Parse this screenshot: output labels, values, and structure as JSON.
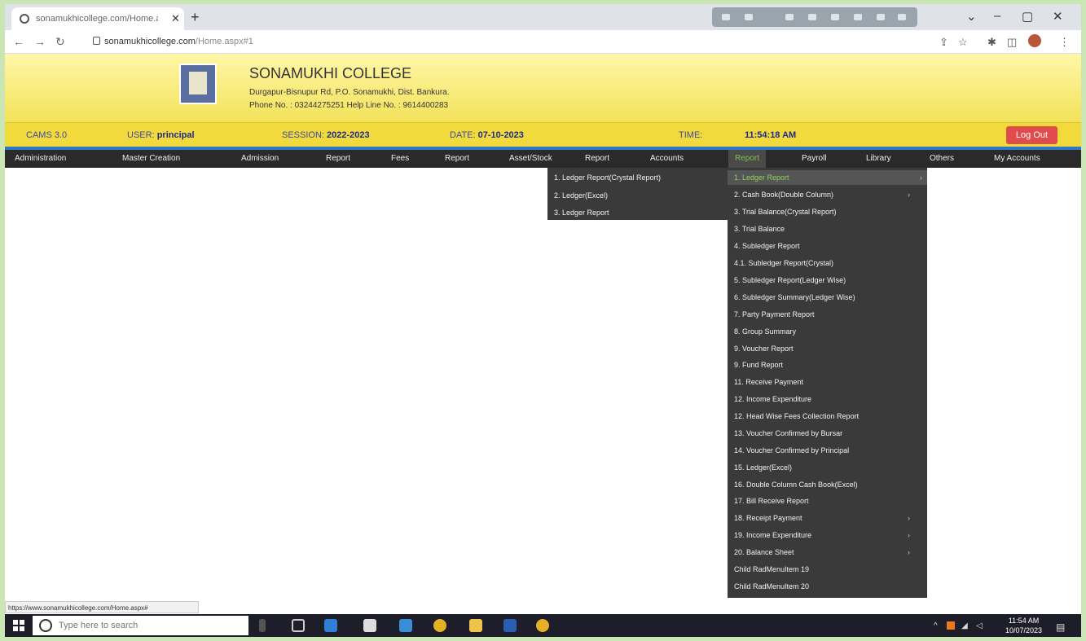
{
  "browser": {
    "tab_title": "sonamukhicollege.com/Home.a",
    "url_domain": "sonamukhicollege.com",
    "url_path": "/Home.aspx#1",
    "status_url": "https://www.sonamukhicollege.com/Home.aspx#"
  },
  "college": {
    "name": "SONAMUKHI COLLEGE",
    "address": "Durgapur-Bisnupur Rd, P.O. Sonamukhi, Dist. Bankura.",
    "phone": "Phone No. : 03244275251  Help Line No. : 9614400283"
  },
  "info": {
    "cams": "CAMS 3.0",
    "user_label": "USER:",
    "user_value": "principal",
    "session_label": "SESSION:",
    "session_value": "2022-2023",
    "date_label": "DATE:",
    "date_value": "07-10-2023",
    "time_label": "TIME:",
    "time_value": "11:54:18 AM",
    "logout": "Log Out"
  },
  "menu": [
    "Administration",
    "Master Creation",
    "Admission",
    "Report",
    "Fees",
    "Report",
    "Asset/Stock",
    "Report",
    "Accounts",
    "Report",
    "Payroll",
    "Library",
    "Others",
    "My Accounts"
  ],
  "submenu_ledger": [
    "1. Ledger Report(Crystal Report)",
    "2. Ledger(Excel)",
    "3. Ledger Report"
  ],
  "submenu_report": [
    "1. Ledger Report",
    "2. Cash Book(Double Column)",
    "3. Trial Balance(Crystal Report)",
    "3. Trial Balance",
    "4. Subledger Report",
    "4.1. Subledger Report(Crystal)",
    "5. Subledger Report(Ledger Wise)",
    "6. Subledger Summary(Ledger Wise)",
    "7. Party Payment Report",
    "8. Group Summary",
    "9. Voucher Report",
    "9. Fund Report",
    "11. Receive Payment",
    "12. Income Expenditure",
    "12. Head Wise Fees Collection Report",
    "13. Voucher Confirmed by Bursar",
    "14. Voucher Confirmed by Principal",
    "15. Ledger(Excel)",
    "16. Double Column Cash Book(Excel)",
    "17. Bill Receive Report",
    "18. Receipt Payment",
    "19. Income Expenditure",
    "20. Balance Sheet",
    "Child RadMenuItem 19",
    "Child RadMenuItem 20"
  ],
  "taskbar": {
    "search_placeholder": "Type here to search",
    "time": "11:54 AM",
    "date": "10/07/2023"
  }
}
